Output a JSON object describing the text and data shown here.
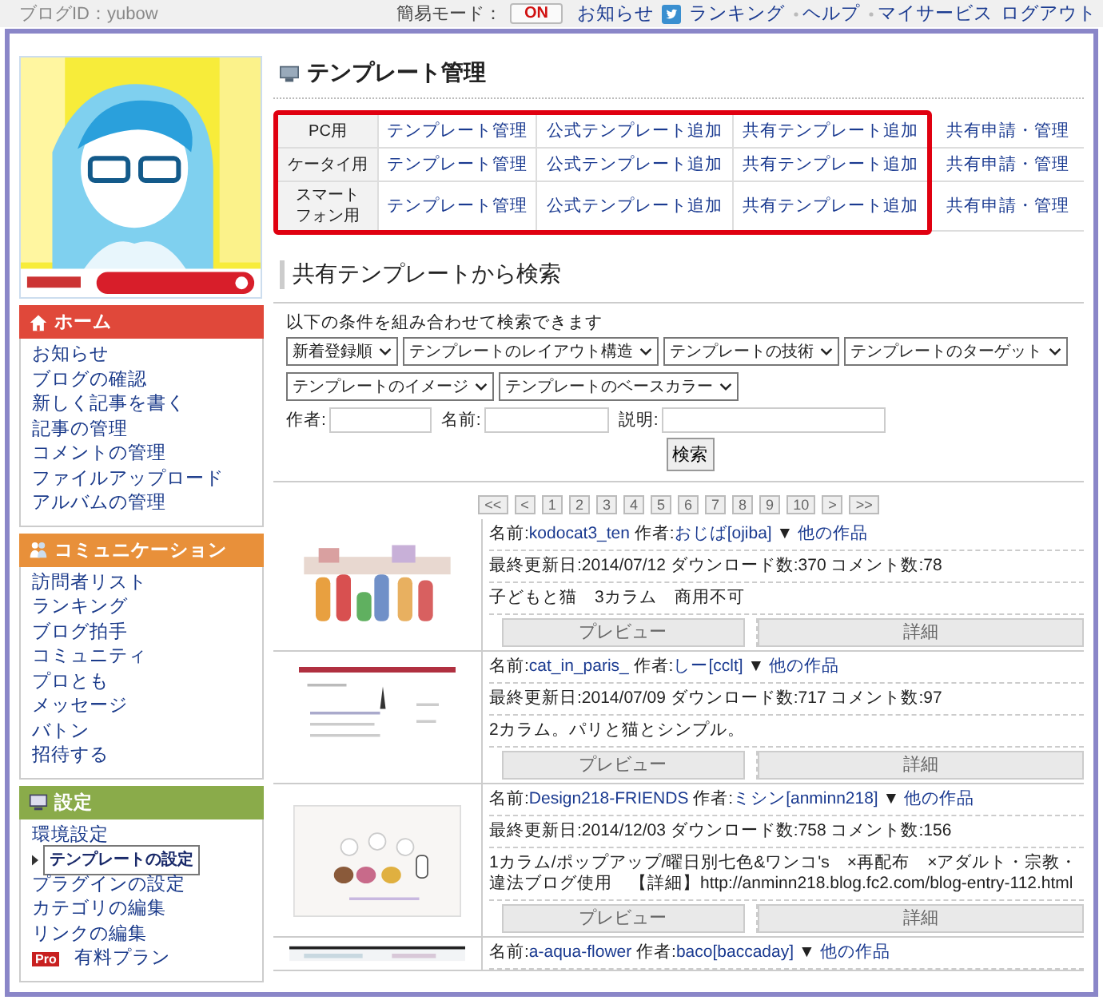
{
  "top_bar": {
    "blog_id": "ブログID：yubow",
    "easy_mode_label": "簡易モード：",
    "easy_mode": {
      "label": "ON",
      "on": true
    },
    "links": [
      {
        "label": "お知らせ",
        "kind": "plain"
      },
      {
        "label": "ランキング",
        "kind": "twitter"
      },
      {
        "label": "ヘルプ",
        "kind": "dotted"
      },
      {
        "label": "マイサービス",
        "kind": "dotted"
      },
      {
        "label": "ログアウト",
        "kind": "plain"
      }
    ]
  },
  "sidebar": {
    "sections": [
      {
        "title": "ホーム",
        "kind": "home",
        "color": "#e0483a",
        "items": [
          {
            "label": "お知らせ",
            "selected": false
          },
          {
            "label": "ブログの確認",
            "selected": false
          },
          {
            "label": "新しく記事を書く",
            "selected": false
          },
          {
            "label": "記事の管理",
            "selected": false
          },
          {
            "label": "コメントの管理",
            "selected": false
          },
          {
            "label": "ファイルアップロード",
            "selected": false
          },
          {
            "label": "アルバムの管理",
            "selected": false
          }
        ]
      },
      {
        "title": "コミュニケーション",
        "kind": "people",
        "color": "#e8903a",
        "items": [
          {
            "label": "訪問者リスト",
            "selected": false
          },
          {
            "label": "ランキング",
            "selected": false
          },
          {
            "label": "ブログ拍手",
            "selected": false
          },
          {
            "label": "コミュニティ",
            "selected": false
          },
          {
            "label": "プロとも",
            "selected": false
          },
          {
            "label": "メッセージ",
            "selected": false
          },
          {
            "label": "バトン",
            "selected": false
          },
          {
            "label": "招待する",
            "selected": false
          }
        ]
      },
      {
        "title": "設定",
        "kind": "monitor",
        "color": "#8aab4a",
        "items": [
          {
            "label": "環境設定",
            "selected": false
          },
          {
            "label": "テンプレートの設定",
            "selected": true
          },
          {
            "label": "プラグインの設定",
            "selected": false
          },
          {
            "label": "カテゴリの編集",
            "selected": false
          },
          {
            "label": "リンクの編集",
            "selected": false
          },
          {
            "label": "有料プラン",
            "selected": false,
            "badge": "Pro"
          }
        ]
      }
    ]
  },
  "manage": {
    "title": "テンプレート管理",
    "rows": [
      {
        "label": [
          "PC用"
        ],
        "links": [
          "テンプレート管理",
          "公式テンプレート追加",
          "共有テンプレート追加"
        ],
        "extra": "共有申請・管理"
      },
      {
        "label": [
          "ケータイ用"
        ],
        "links": [
          "テンプレート管理",
          "公式テンプレート追加",
          "共有テンプレート追加"
        ],
        "extra": "共有申請・管理"
      },
      {
        "label": [
          "スマート",
          "フォン用"
        ],
        "links": [
          "テンプレート管理",
          "公式テンプレート追加",
          "共有テンプレート追加"
        ],
        "extra": "共有申請・管理"
      }
    ]
  },
  "search": {
    "title": "共有テンプレートから検索",
    "description": "以下の条件を組み合わせて検索できます",
    "select_rows": [
      [
        "新着登録順",
        "テンプレートのレイアウト構造",
        "テンプレートの技術",
        "テンプレートのターゲット"
      ],
      [
        "テンプレートのイメージ",
        "テンプレートのベースカラー"
      ]
    ],
    "fields": [
      {
        "label": "作者:"
      },
      {
        "label": "名前:"
      },
      {
        "label": "説明:"
      }
    ],
    "button": "検索"
  },
  "pagination": [
    "<<",
    "<",
    "1",
    "2",
    "3",
    "4",
    "5",
    "6",
    "7",
    "8",
    "9",
    "10",
    ">",
    ">>"
  ],
  "templates": [
    {
      "name_label": "名前:",
      "name": "kodocat3_ten",
      "author_label": "作者:",
      "author": "おじば[ojiba]",
      "marker": "▼",
      "other": "他の作品",
      "stats": "最終更新日:2014/07/12 ダウンロード数:370 コメント数:78",
      "description": "子どもと猫　3カラム　商用不可",
      "buttons": [
        "プレビュー",
        "詳細"
      ]
    },
    {
      "name_label": "名前:",
      "name": "cat_in_paris_",
      "author_label": "作者:",
      "author": "しー[cclt]",
      "marker": "▼",
      "other": "他の作品",
      "stats": "最終更新日:2014/07/09 ダウンロード数:717 コメント数:97",
      "description": "2カラム。パリと猫とシンプル。",
      "buttons": [
        "プレビュー",
        "詳細"
      ]
    },
    {
      "name_label": "名前:",
      "name": "Design218-FRIENDS",
      "author_label": "作者:",
      "author": "ミシン[anminn218]",
      "marker": "▼",
      "other": "他の作品",
      "stats": "最終更新日:2014/12/03 ダウンロード数:758 コメント数:156",
      "description": "1カラム/ポップアップ/曜日別七色&ワンコ's　×再配布　×アダルト・宗教・違法ブログ使用　【詳細】http://anminn218.blog.fc2.com/blog-entry-112.html",
      "buttons": [
        "プレビュー",
        "詳細"
      ]
    },
    {
      "name_label": "名前:",
      "name": "a-aqua-flower",
      "author_label": "作者:",
      "author": "baco[baccaday]",
      "marker": "▼",
      "other": "他の作品"
    }
  ]
}
